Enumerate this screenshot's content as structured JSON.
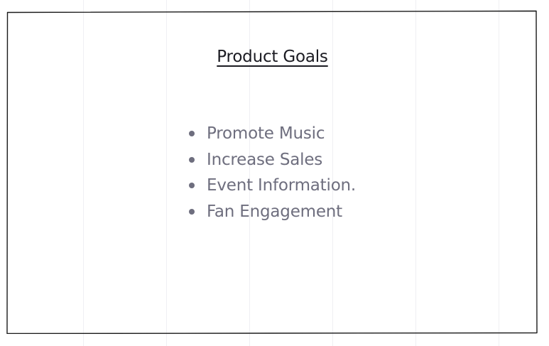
{
  "slide": {
    "title": "Product Goals",
    "goals": [
      "Promote Music",
      "Increase Sales",
      "Event Information.",
      "Fan Engagement"
    ]
  },
  "colors": {
    "title_text": "#1b1b22",
    "list_text": "#6e6e7e",
    "frame_stroke": "#1a1a1a",
    "grid_line": "#efeff3",
    "background": "#ffffff"
  }
}
